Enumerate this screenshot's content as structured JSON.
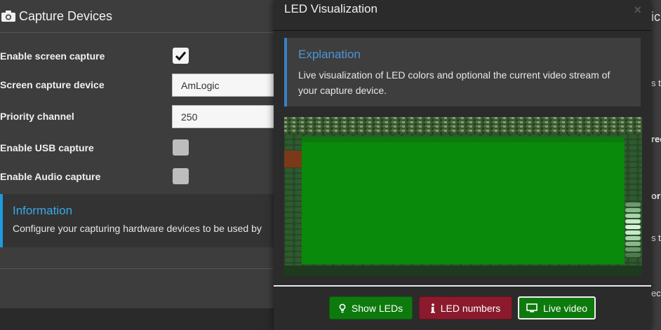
{
  "background_panel": {
    "title": "Capture Devices",
    "rows": [
      {
        "label": "Enable screen capture",
        "type": "checkbox",
        "checked": true
      },
      {
        "label": "Screen capture device",
        "type": "input",
        "value": "AmLogic"
      },
      {
        "label": "Priority channel",
        "type": "input",
        "value": "250"
      },
      {
        "label": "Enable USB capture",
        "type": "checkbox",
        "checked": false
      },
      {
        "label": "Enable Audio capture",
        "type": "checkbox",
        "checked": false
      }
    ],
    "info": {
      "title": "Information",
      "text": "Configure your capturing hardware devices to be used by"
    }
  },
  "right_strip": {
    "title_frag": "ic",
    "frags": [
      "s t",
      "ree",
      "ori",
      "s t",
      "ec"
    ]
  },
  "modal": {
    "title": "LED Visualization",
    "close": "×",
    "explanation": {
      "title": "Explanation",
      "text": "Live visualization of LED colors and optional the current video stream of your capture device."
    },
    "buttons": {
      "show_leds": "Show LEDs",
      "led_numbers": "LED numbers",
      "live_video": "Live video"
    }
  },
  "colors": {
    "accent_blue": "#3a7fc8",
    "info_blue": "#1e9be0",
    "green": "#0d7a0d",
    "crimson": "#8b1a2d",
    "video_green": "#109410"
  },
  "icons": {
    "header": "camera-icon",
    "check": "checkmark-icon",
    "show_leds": "lightbulb-icon",
    "led_numbers": "info-icon",
    "live_video": "monitor-icon"
  }
}
